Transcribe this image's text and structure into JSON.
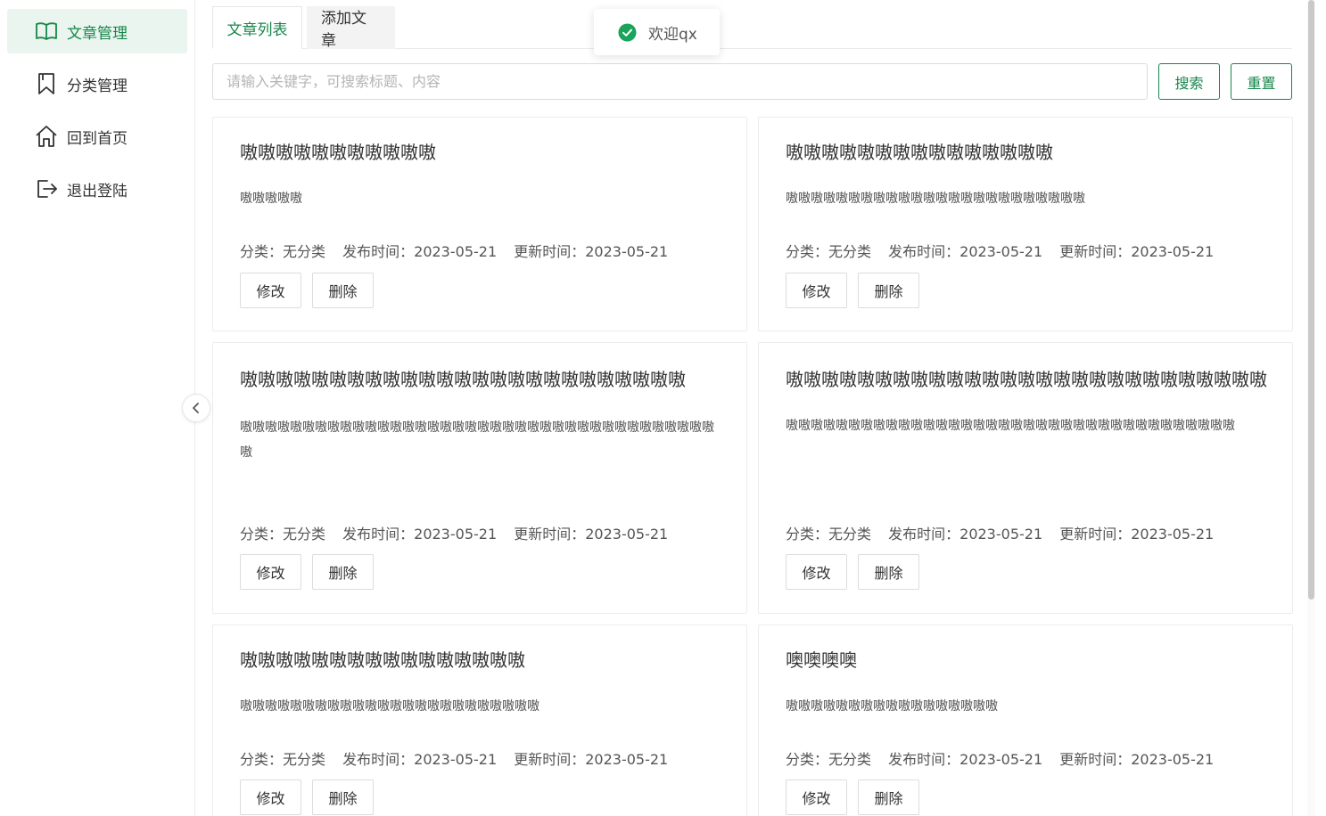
{
  "sidebar": {
    "items": [
      {
        "label": "文章管理",
        "icon": "book-open-icon",
        "active": true
      },
      {
        "label": "分类管理",
        "icon": "bookmark-icon",
        "active": false
      },
      {
        "label": "回到首页",
        "icon": "home-icon",
        "active": false
      },
      {
        "label": "退出登陆",
        "icon": "logout-icon",
        "active": false
      }
    ]
  },
  "tabs": [
    {
      "label": "文章列表",
      "active": true
    },
    {
      "label": "添加文章",
      "active": false
    }
  ],
  "toast": {
    "message": "欢迎qx",
    "icon": "success-check-icon"
  },
  "search": {
    "placeholder": "请输入关键字，可搜索标题、内容",
    "value": "",
    "search_label": "搜索",
    "reset_label": "重置"
  },
  "meta_labels": {
    "category": "分类：",
    "published": "发布时间：",
    "updated": "更新时间："
  },
  "actions": {
    "edit": "修改",
    "delete": "删除"
  },
  "articles": [
    {
      "title": "嗷嗷嗷嗷嗷嗷嗷嗷嗷嗷嗷",
      "desc": "嗷嗷嗷嗷嗷",
      "category": "无分类",
      "published": "2023-05-21",
      "updated": "2023-05-21"
    },
    {
      "title": "嗷嗷嗷嗷嗷嗷嗷嗷嗷嗷嗷嗷嗷嗷嗷",
      "desc": "嗷嗷嗷嗷嗷嗷嗷嗷嗷嗷嗷嗷嗷嗷嗷嗷嗷嗷嗷嗷嗷嗷嗷嗷",
      "category": "无分类",
      "published": "2023-05-21",
      "updated": "2023-05-21"
    },
    {
      "title": "嗷嗷嗷嗷嗷嗷嗷嗷嗷嗷嗷嗷嗷嗷嗷嗷嗷嗷嗷嗷嗷嗷嗷嗷嗷",
      "desc": "嗷嗷嗷嗷嗷嗷嗷嗷嗷嗷嗷嗷嗷嗷嗷嗷嗷嗷嗷嗷嗷嗷嗷嗷嗷嗷嗷嗷嗷嗷嗷嗷嗷嗷嗷嗷嗷嗷嗷",
      "category": "无分类",
      "published": "2023-05-21",
      "updated": "2023-05-21"
    },
    {
      "title": "嗷嗷嗷嗷嗷嗷嗷嗷嗷嗷嗷嗷嗷嗷嗷嗷嗷嗷嗷嗷嗷嗷嗷嗷嗷嗷嗷",
      "desc": "嗷嗷嗷嗷嗷嗷嗷嗷嗷嗷嗷嗷嗷嗷嗷嗷嗷嗷嗷嗷嗷嗷嗷嗷嗷嗷嗷嗷嗷嗷嗷嗷嗷嗷嗷嗷",
      "category": "无分类",
      "published": "2023-05-21",
      "updated": "2023-05-21"
    },
    {
      "title": "嗷嗷嗷嗷嗷嗷嗷嗷嗷嗷嗷嗷嗷嗷嗷嗷",
      "desc": "嗷嗷嗷嗷嗷嗷嗷嗷嗷嗷嗷嗷嗷嗷嗷嗷嗷嗷嗷嗷嗷嗷嗷嗷",
      "category": "无分类",
      "published": "2023-05-21",
      "updated": "2023-05-21"
    },
    {
      "title": "噢噢噢噢",
      "desc": "嗷嗷嗷嗷嗷嗷嗷嗷嗷嗷嗷嗷嗷嗷嗷嗷嗷",
      "category": "无分类",
      "published": "2023-05-21",
      "updated": "2023-05-21"
    }
  ],
  "colors": {
    "accent": "#18864b",
    "active_bg": "#e9f5ee",
    "success": "#1aa35a"
  }
}
